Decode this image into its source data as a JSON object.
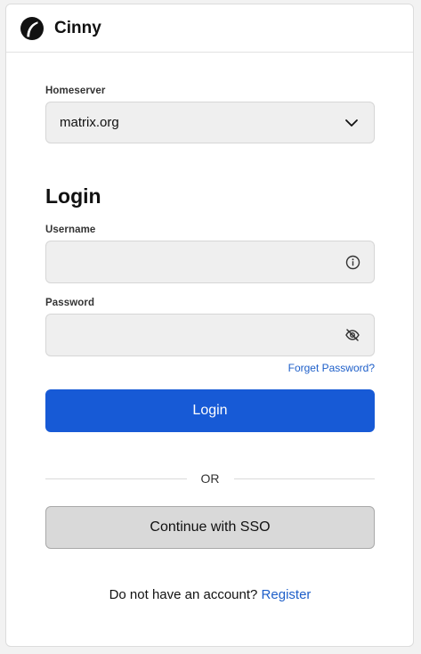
{
  "header": {
    "app_name": "Cinny",
    "logo_icon": "cinny-logo-icon"
  },
  "homeserver": {
    "label": "Homeserver",
    "value": "matrix.org",
    "icon": "chevron-down-icon"
  },
  "login_form": {
    "title": "Login",
    "username_label": "Username",
    "username_value": "",
    "username_icon": "info-icon",
    "password_label": "Password",
    "password_value": "",
    "password_icon": "eye-off-icon",
    "forgot_password": "Forget Password?",
    "login_button": "Login"
  },
  "divider": {
    "text": "OR"
  },
  "sso": {
    "button": "Continue with SSO"
  },
  "register": {
    "prompt": "Do not have an account?",
    "link": "Register"
  },
  "colors": {
    "primary": "#175ad6",
    "link": "#1e5fc9",
    "input_bg": "#efefef",
    "sso_bg": "#d9d9d9"
  }
}
